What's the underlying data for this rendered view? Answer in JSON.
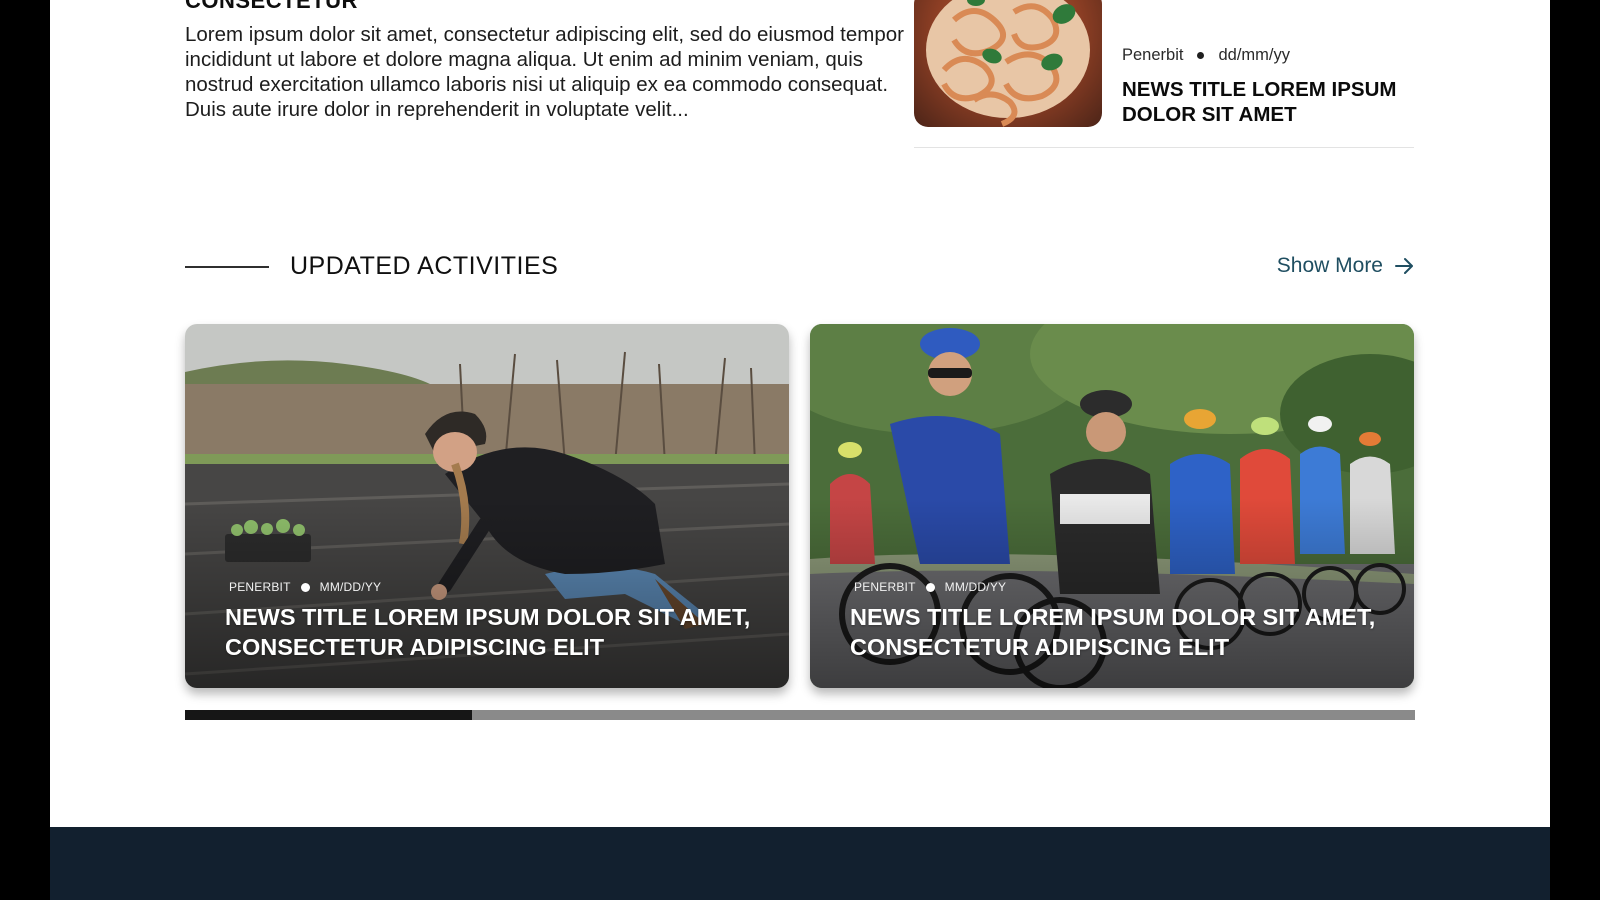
{
  "article": {
    "heading_cut": "CONSECTETUR",
    "excerpt": "Lorem ipsum dolor sit amet, consectetur adipiscing elit, sed do eiusmod tempor incididunt ut labore et dolore magna aliqua. Ut enim ad minim veniam, quis nostrud exercitation ullamco laboris nisi ut aliquip ex ea commodo consequat. Duis aute irure dolor in reprehenderit in voluptate velit..."
  },
  "side_news": {
    "publisher": "Penerbit",
    "date": "dd/mm/yy",
    "title": "NEWS TITLE LOREM IPSUM DOLOR SIT AMET",
    "thumb_icon": "pasta-dish-photo"
  },
  "section": {
    "title": "UPDATED ACTIVITIES",
    "show_more": "Show More",
    "show_more_icon": "arrow-right-icon"
  },
  "cards": [
    {
      "publisher": "PENERBIT",
      "date": "MM/DD/YY",
      "title": "NEWS TITLE LOREM IPSUM DOLOR SIT AMET, CONSECTETUR ADIPISCING ELIT",
      "image": "farmer-planting-photo"
    },
    {
      "publisher": "PENERBIT",
      "date": "MM/DD/YY",
      "title": "NEWS TITLE LOREM IPSUM DOLOR SIT AMET, CONSECTETUR ADIPISCING ELIT",
      "image": "cyclists-race-photo"
    }
  ],
  "carousel": {
    "progress_fraction": 0.233
  },
  "colors": {
    "accent": "#1f4e61",
    "footer_bg": "#12202f",
    "progress_track": "#8a8a8a",
    "progress_fill": "#161616"
  }
}
